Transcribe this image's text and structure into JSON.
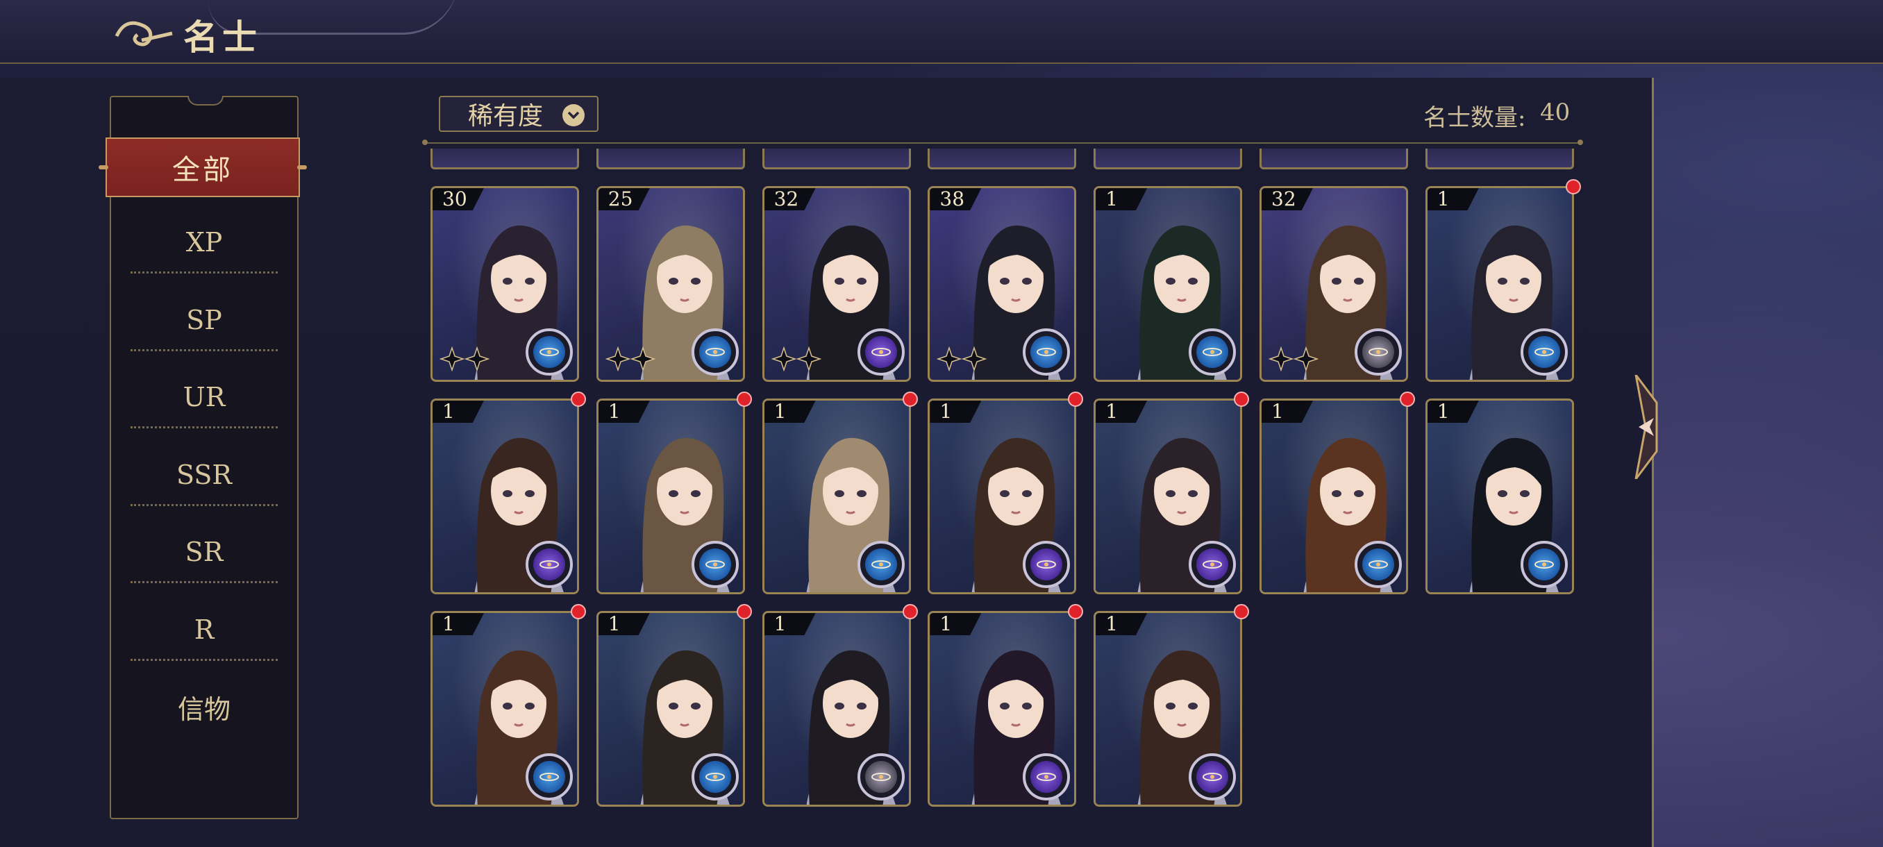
{
  "header": {
    "title": "名士"
  },
  "sidebar": {
    "active": "全部",
    "items": [
      "XP",
      "SP",
      "UR",
      "SSR",
      "SR",
      "R",
      "信物"
    ]
  },
  "filter": {
    "label": "稀有度"
  },
  "count": {
    "label": "名士数量:",
    "value": "40"
  },
  "colors": {
    "panel": "#1b1b31",
    "gold": "#9b8454",
    "active_tab": "#8c2c27",
    "red_dot": "#e0232b"
  },
  "cards": [
    {
      "level": "30",
      "bg": "#3a3a7a",
      "hair": "#2a2230",
      "emblem": "blue",
      "stars": true,
      "dot": false
    },
    {
      "level": "25",
      "bg": "#3d3a78",
      "hair": "#8f7d63",
      "emblem": "blue",
      "stars": true,
      "dot": false
    },
    {
      "level": "32",
      "bg": "#3a3874",
      "hair": "#1c1a22",
      "emblem": "purple",
      "stars": true,
      "dot": false
    },
    {
      "level": "38",
      "bg": "#403a80",
      "hair": "#1e1e2a",
      "emblem": "blue",
      "stars": true,
      "dot": false
    },
    {
      "level": "1",
      "bg": "#2f3a62",
      "hair": "#1c2a26",
      "emblem": "blue",
      "stars": false,
      "dot": false
    },
    {
      "level": "32",
      "bg": "#433d7e",
      "hair": "#4a3428",
      "emblem": "gray",
      "stars": true,
      "dot": false
    },
    {
      "level": "1",
      "bg": "#2e3c66",
      "hair": "#24222e",
      "emblem": "blue",
      "stars": false,
      "dot": true
    },
    {
      "level": "1",
      "bg": "#2f3e66",
      "hair": "#3a2620",
      "emblem": "purple",
      "stars": false,
      "dot": true
    },
    {
      "level": "1",
      "bg": "#304068",
      "hair": "#6a5642",
      "emblem": "blue",
      "stars": false,
      "dot": true
    },
    {
      "level": "1",
      "bg": "#2e4064",
      "hair": "#a08a70",
      "emblem": "blue",
      "stars": false,
      "dot": true
    },
    {
      "level": "1",
      "bg": "#2e3c62",
      "hair": "#3c2a22",
      "emblem": "purple",
      "stars": false,
      "dot": true
    },
    {
      "level": "1",
      "bg": "#304064",
      "hair": "#2a2228",
      "emblem": "purple",
      "stars": false,
      "dot": true
    },
    {
      "level": "1",
      "bg": "#2c3a5e",
      "hair": "#5a3420",
      "emblem": "blue",
      "stars": false,
      "dot": true
    },
    {
      "level": "1",
      "bg": "#2e3f66",
      "hair": "#14161f",
      "emblem": "blue",
      "stars": false,
      "dot": false
    },
    {
      "level": "1",
      "bg": "#304068",
      "hair": "#4a2e22",
      "emblem": "blue",
      "stars": false,
      "dot": true
    },
    {
      "level": "1",
      "bg": "#2f4266",
      "hair": "#2c2420",
      "emblem": "blue",
      "stars": false,
      "dot": true
    },
    {
      "level": "1",
      "bg": "#304068",
      "hair": "#1e1c22",
      "emblem": "gray",
      "stars": false,
      "dot": true
    },
    {
      "level": "1",
      "bg": "#2f3d64",
      "hair": "#22182a",
      "emblem": "purple",
      "stars": false,
      "dot": true
    },
    {
      "level": "1",
      "bg": "#2e3c62",
      "hair": "#3a2620",
      "emblem": "purple",
      "stars": false,
      "dot": true
    }
  ]
}
